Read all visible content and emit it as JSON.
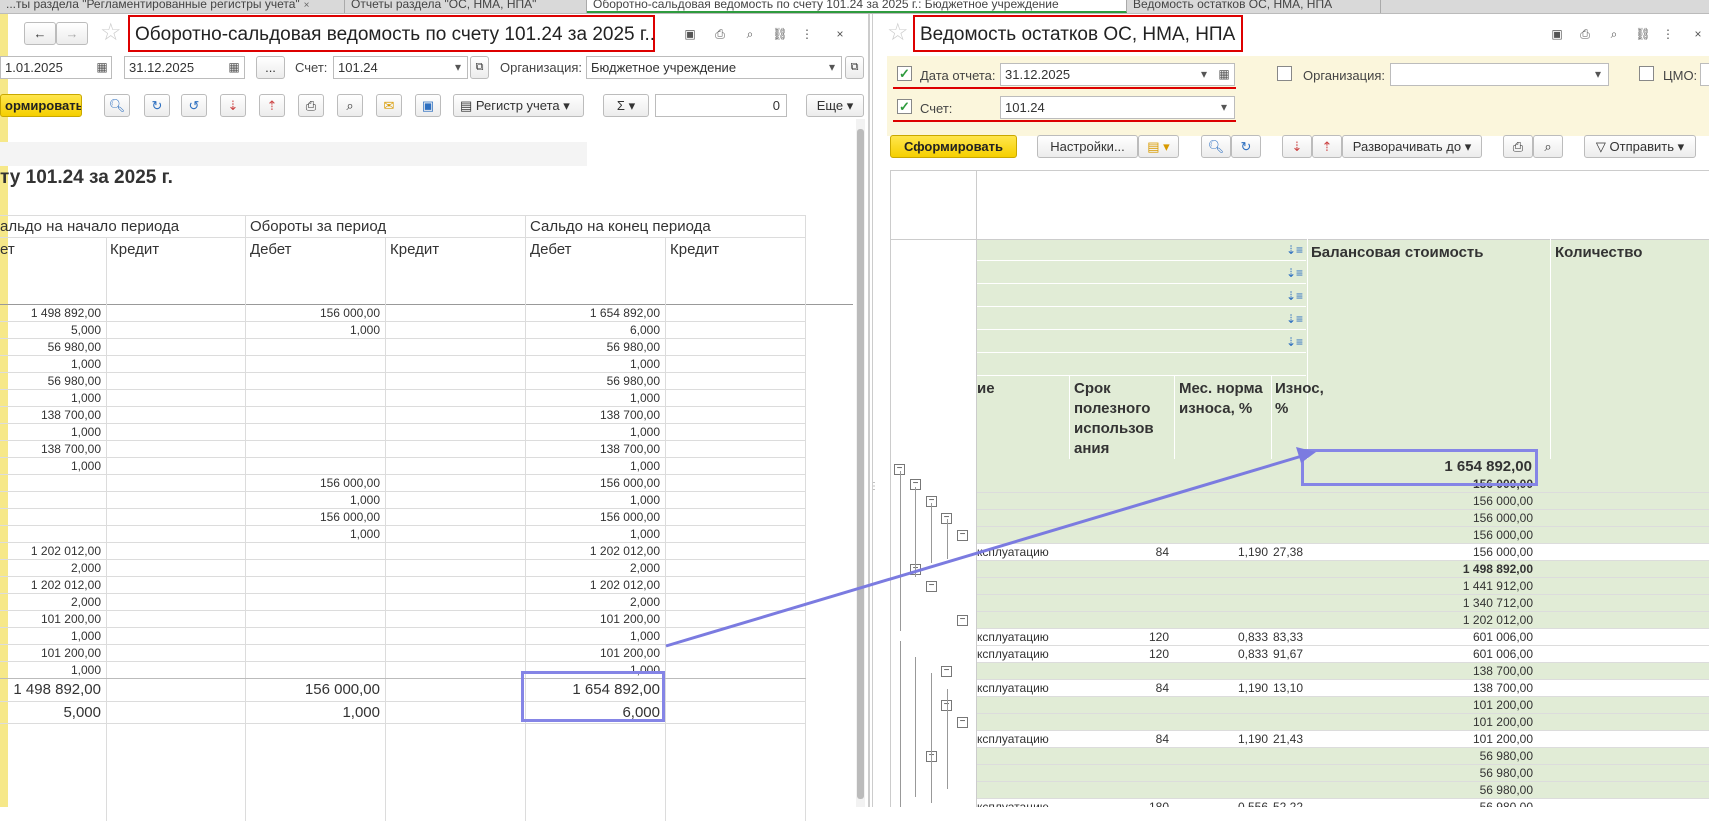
{
  "tabs": [
    {
      "label": "...ты раздела \"Регламентированные регистры учета\""
    },
    {
      "label": "Отчеты раздела \"ОС, НМА, НПА\""
    },
    {
      "label": "Оборотно-сальдовая ведомость по счету 101.24 за 2025 г.: Бюджетное учреждение"
    },
    {
      "label": "Ведомость остатков ОС, НМА, НПА"
    }
  ],
  "left": {
    "title": "Оборотно-сальдовая ведомость по счету 101.24 за 2025 г..",
    "date_from": "1.01.2025",
    "date_to": "31.12.2025",
    "ellipsis": "...",
    "account_label": "Счет:",
    "account_value": "101.24",
    "org_label": "Организация:",
    "org_value": "Бюджетное учреждение",
    "generate_label": "ормировать",
    "register_label": "Регистр учета",
    "sum_label": "Σ",
    "sum_value": "0",
    "more_label": "Еще",
    "report_title": "ту 101.24 за 2025 г.",
    "col_opening": "альдо на начало периода",
    "col_turnover": "Обороты за период",
    "col_closing": "Сальдо на конец периода",
    "debit": "Дебет",
    "debit_cut": "ет",
    "credit": "Кредит",
    "rows": [
      {
        "open": "1 498 892,00",
        "turn": "156 000,00",
        "close": "1 654 892,00"
      },
      {
        "open": "5,000",
        "turn": "1,000",
        "close": "6,000"
      },
      {
        "open": "56 980,00",
        "turn": "",
        "close": "56 980,00"
      },
      {
        "open": "1,000",
        "turn": "",
        "close": "1,000"
      },
      {
        "open": "56 980,00",
        "turn": "",
        "close": "56 980,00"
      },
      {
        "open": "1,000",
        "turn": "",
        "close": "1,000"
      },
      {
        "open": "138 700,00",
        "turn": "",
        "close": "138 700,00"
      },
      {
        "open": "1,000",
        "turn": "",
        "close": "1,000"
      },
      {
        "open": "138 700,00",
        "turn": "",
        "close": "138 700,00"
      },
      {
        "open": "1,000",
        "turn": "",
        "close": "1,000"
      },
      {
        "open": "",
        "turn": "156 000,00",
        "close": "156 000,00"
      },
      {
        "open": "",
        "turn": "1,000",
        "close": "1,000"
      },
      {
        "open": "",
        "turn": "156 000,00",
        "close": "156 000,00"
      },
      {
        "open": "",
        "turn": "1,000",
        "close": "1,000"
      },
      {
        "open": "1 202 012,00",
        "turn": "",
        "close": "1 202 012,00"
      },
      {
        "open": "2,000",
        "turn": "",
        "close": "2,000"
      },
      {
        "open": "1 202 012,00",
        "turn": "",
        "close": "1 202 012,00"
      },
      {
        "open": "2,000",
        "turn": "",
        "close": "2,000"
      },
      {
        "open": "101 200,00",
        "turn": "",
        "close": "101 200,00"
      },
      {
        "open": "1,000",
        "turn": "",
        "close": "1,000"
      },
      {
        "open": "101 200,00",
        "turn": "",
        "close": "101 200,00"
      },
      {
        "open": "1,000",
        "turn": "",
        "close": "1,000"
      }
    ],
    "total_open": "1 498 892,00",
    "total_turn": "156 000,00",
    "total_close": "1 654 892,00",
    "total2_open": "5,000",
    "total2_turn": "1,000",
    "total2_close": "6,000"
  },
  "right": {
    "title": "Ведомость остатков ОС, НМА, НПА",
    "date_label": "Дата отчета:",
    "date_value": "31.12.2025",
    "org_label": "Организация:",
    "cmo_label": "ЦМО:",
    "account_label": "Счет:",
    "account_value": "101.24",
    "generate_label": "Сформировать",
    "settings_label": "Настройки...",
    "expand_label": "Разворачивать до",
    "send_label": "Отправить",
    "col_balance": "Балансовая стоимость",
    "col_qty": "Количество",
    "col_name_cut": "ие",
    "col_life": "Срок полезного использов ания",
    "col_norm": "Мес. норма износа, %",
    "col_wear": "Износ, %",
    "total": "1 654 892,00",
    "op_text": "ксплуатацию",
    "rows": [
      {
        "op": false,
        "life": "",
        "norm": "",
        "wear": "",
        "bal": "156 000,00",
        "bold": true
      },
      {
        "op": false,
        "life": "",
        "norm": "",
        "wear": "",
        "bal": "156 000,00",
        "bold": false
      },
      {
        "op": false,
        "life": "",
        "norm": "",
        "wear": "",
        "bal": "156 000,00",
        "bold": false
      },
      {
        "op": false,
        "life": "",
        "norm": "",
        "wear": "",
        "bal": "156 000,00",
        "bold": false
      },
      {
        "op": true,
        "life": "84",
        "norm": "1,190",
        "wear": "27,38",
        "bal": "156 000,00",
        "bold": false
      },
      {
        "op": false,
        "life": "",
        "norm": "",
        "wear": "",
        "bal": "1 498 892,00",
        "bold": true
      },
      {
        "op": false,
        "life": "",
        "norm": "",
        "wear": "",
        "bal": "1 441 912,00",
        "bold": false
      },
      {
        "op": false,
        "life": "",
        "norm": "",
        "wear": "",
        "bal": "1 340 712,00",
        "bold": false
      },
      {
        "op": false,
        "life": "",
        "norm": "",
        "wear": "",
        "bal": "1 202 012,00",
        "bold": false
      },
      {
        "op": true,
        "life": "120",
        "norm": "0,833",
        "wear": "83,33",
        "bal": "601 006,00",
        "bold": false
      },
      {
        "op": true,
        "life": "120",
        "norm": "0,833",
        "wear": "91,67",
        "bal": "601 006,00",
        "bold": false
      },
      {
        "op": false,
        "life": "",
        "norm": "",
        "wear": "",
        "bal": "138 700,00",
        "bold": false
      },
      {
        "op": true,
        "life": "84",
        "norm": "1,190",
        "wear": "13,10",
        "bal": "138 700,00",
        "bold": false
      },
      {
        "op": false,
        "life": "",
        "norm": "",
        "wear": "",
        "bal": "101 200,00",
        "bold": false
      },
      {
        "op": false,
        "life": "",
        "norm": "",
        "wear": "",
        "bal": "101 200,00",
        "bold": false
      },
      {
        "op": true,
        "life": "84",
        "norm": "1,190",
        "wear": "21,43",
        "bal": "101 200,00",
        "bold": false
      },
      {
        "op": false,
        "life": "",
        "norm": "",
        "wear": "",
        "bal": "56 980,00",
        "bold": false
      },
      {
        "op": false,
        "life": "",
        "norm": "",
        "wear": "",
        "bal": "56 980,00",
        "bold": false
      },
      {
        "op": false,
        "life": "",
        "norm": "",
        "wear": "",
        "bal": "56 980,00",
        "bold": false
      },
      {
        "op": true,
        "life": "180",
        "norm": "0,556",
        "wear": "52,22",
        "bal": "56 980,00",
        "bold": false
      }
    ]
  },
  "colors": {
    "accent_red": "#d00000",
    "highlight_blue": "#7b7be0",
    "group_green": "#e1ecd6",
    "button_yellow": "#f5cf00",
    "filter_bg": "#fbf6dc"
  }
}
